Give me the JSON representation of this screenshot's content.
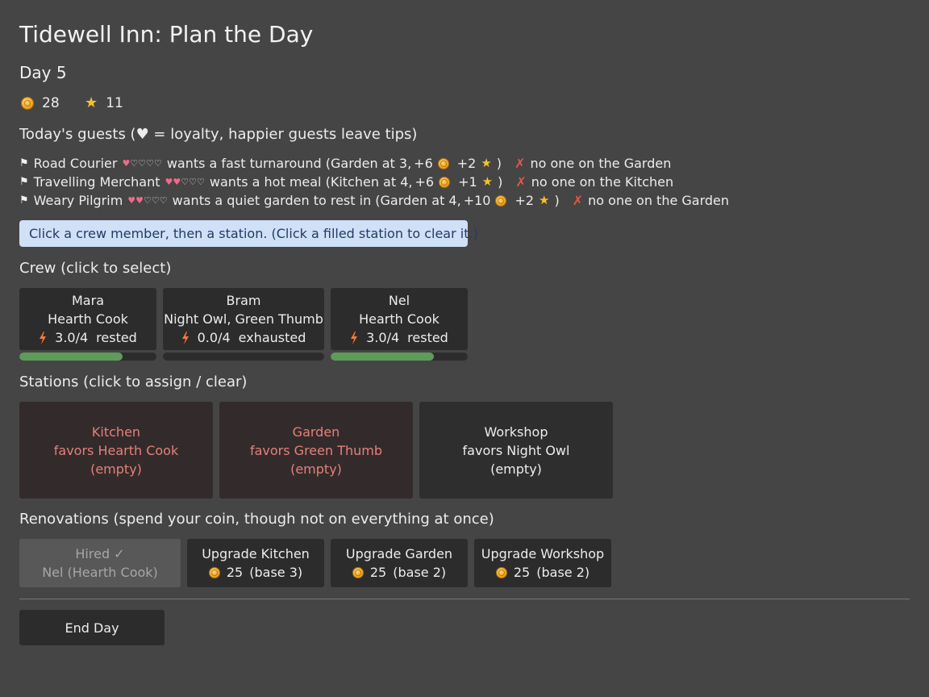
{
  "title": "Tidewell Inn: Plan the Day",
  "day": "Day 5",
  "resources": {
    "coins": "28",
    "stars": "11"
  },
  "guests_header": "Today's guests  (♥ = loyalty, happier guests leave tips)",
  "guests": [
    {
      "name": "Road Courier",
      "loyalty": 1,
      "loyalty_max": 5,
      "request": "wants a fast turnaround (Garden at 3,",
      "coin_reward": "+6",
      "star_reward": "+2",
      "status": "no one on the Garden"
    },
    {
      "name": "Travelling Merchant",
      "loyalty": 2,
      "loyalty_max": 5,
      "request": "wants a hot meal (Kitchen at 4,",
      "coin_reward": "+6",
      "star_reward": "+1",
      "status": "no one on the Kitchen"
    },
    {
      "name": "Weary Pilgrim",
      "loyalty": 2,
      "loyalty_max": 5,
      "request": "wants a quiet garden to rest in (Garden at 4,",
      "coin_reward": "+10",
      "star_reward": "+2",
      "status": "no one on the Garden"
    }
  ],
  "hint": "Click a crew member, then a station.  (Click a filled station to clear it.)",
  "crew_header": "Crew  (click to select)",
  "crew": [
    {
      "name": "Mara",
      "traits": "Hearth Cook",
      "energy": "3.0/4",
      "state": "rested",
      "energy_fraction": 0.75
    },
    {
      "name": "Bram",
      "traits": "Night Owl, Green Thumb",
      "energy": "0.0/4",
      "state": "exhausted",
      "energy_fraction": 0.0
    },
    {
      "name": "Nel",
      "traits": "Hearth Cook",
      "energy": "3.0/4",
      "state": "rested",
      "energy_fraction": 0.75
    }
  ],
  "stations_header": "Stations  (click to assign / clear)",
  "stations": [
    {
      "name": "Kitchen",
      "favors": "favors Hearth Cook",
      "occupant": "(empty)"
    },
    {
      "name": "Garden",
      "favors": "favors Green Thumb",
      "occupant": "(empty)"
    },
    {
      "name": "Workshop",
      "favors": "favors Night Owl",
      "occupant": "(empty)"
    }
  ],
  "renovations_header": "Renovations  (spend your coin, though not on everything at once)",
  "renovations": [
    {
      "title": "Hired ✓",
      "detail": "Nel (Hearth Cook)"
    },
    {
      "title": "Upgrade Kitchen",
      "cost": "25",
      "base": "(base 3)"
    },
    {
      "title": "Upgrade Garden",
      "cost": "25",
      "base": "(base 2)"
    },
    {
      "title": "Upgrade Workshop",
      "cost": "25",
      "base": "(base 2)"
    }
  ],
  "end_day_label": "End Day",
  "colors": {
    "accent_hint_bg": "#cfe0f7",
    "energy_bar": "#5f9c5c",
    "station_alert": "#e4807a",
    "heart": "#f06a8a"
  }
}
